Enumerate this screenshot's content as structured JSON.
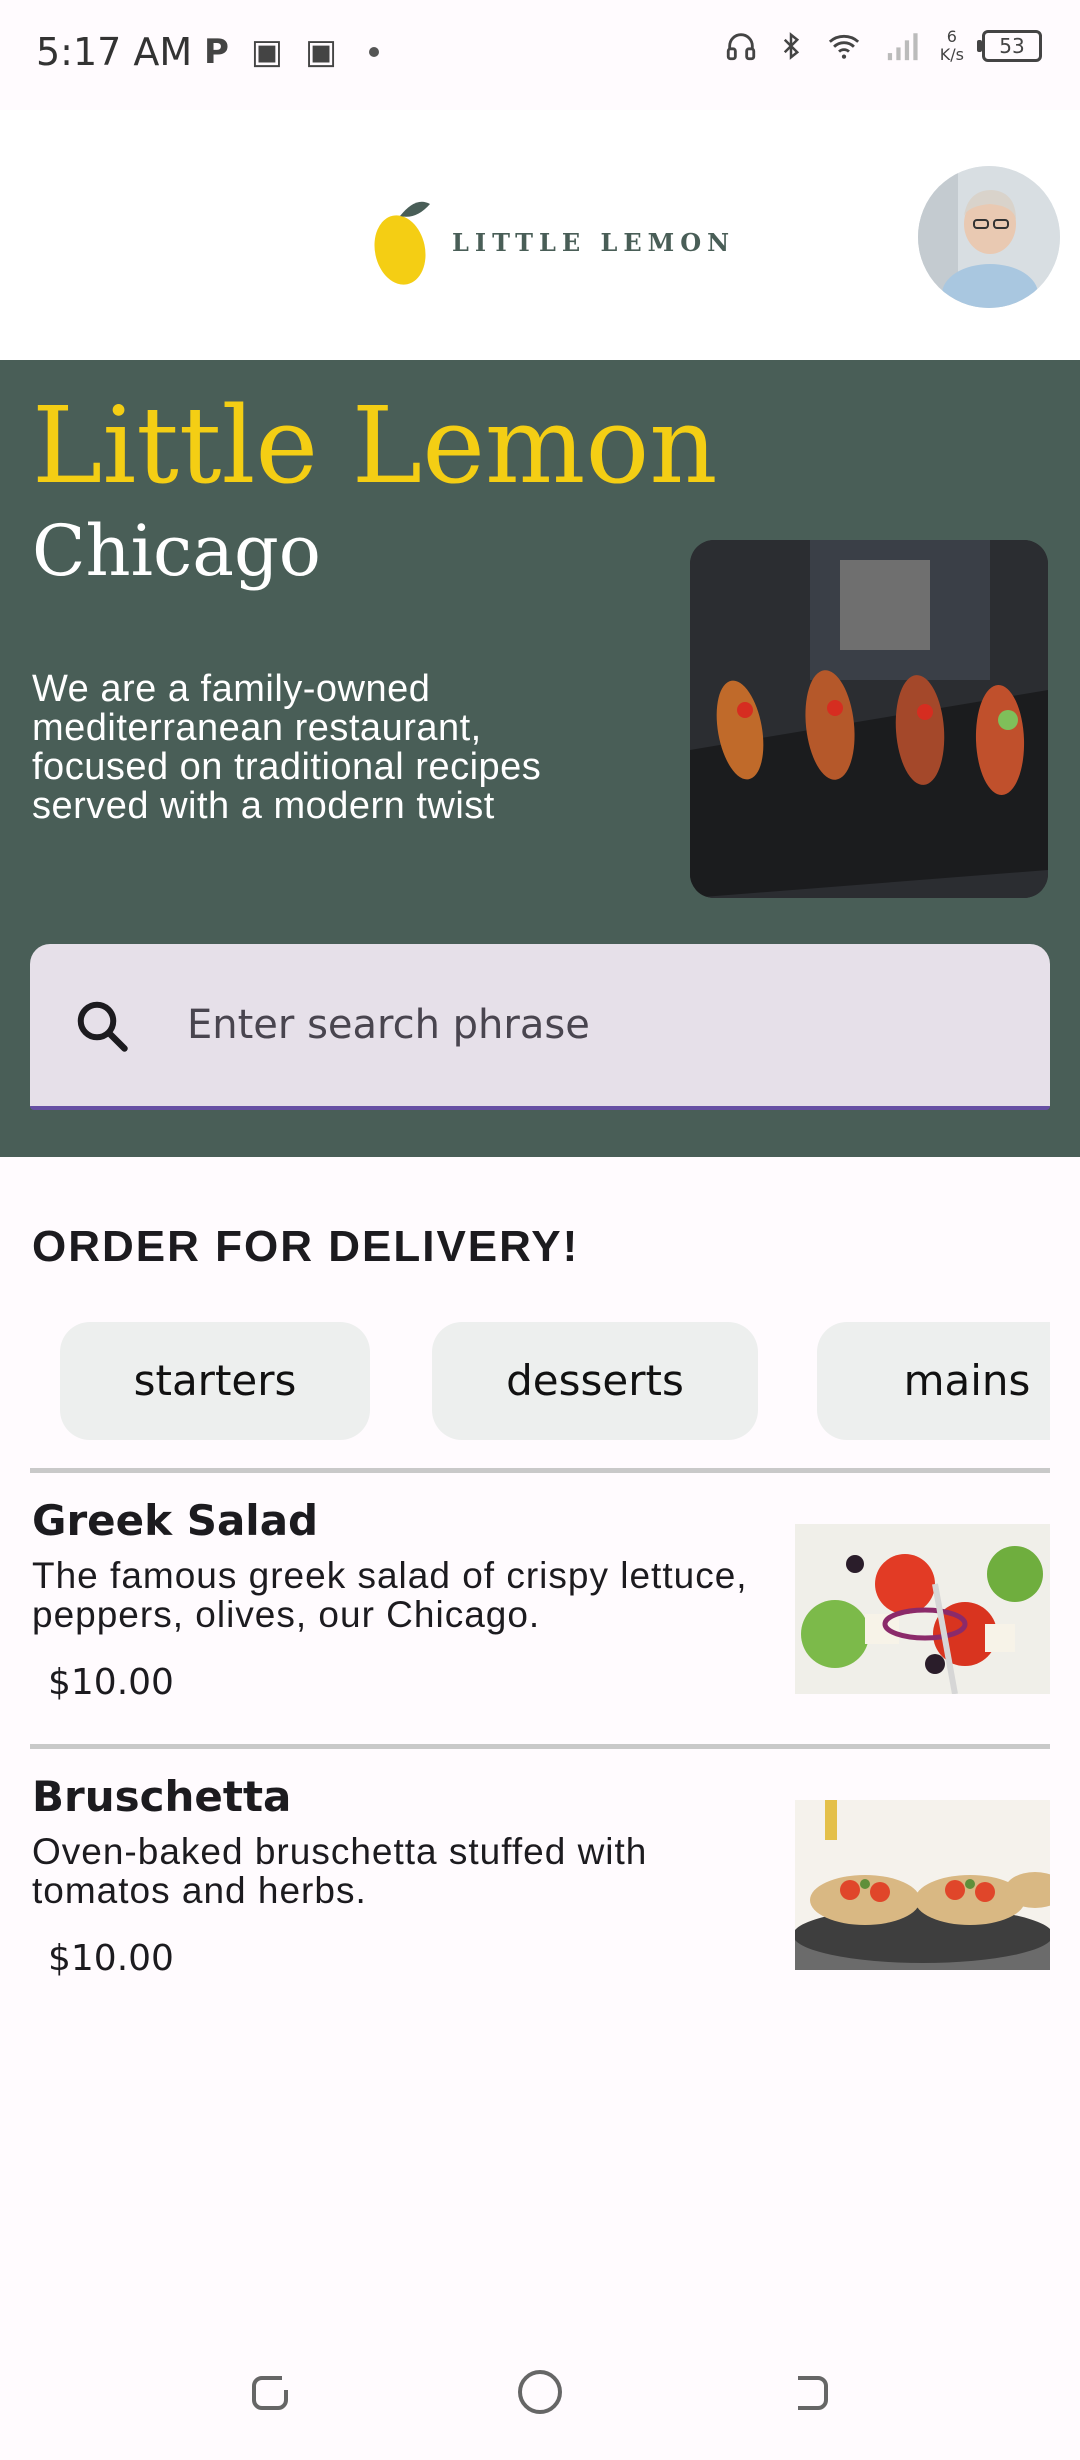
{
  "status_bar": {
    "time": "5:17 AM",
    "left_icons": [
      "parking-icon",
      "app-icon",
      "app-icon",
      "dot"
    ],
    "net_speed_value": "6",
    "net_speed_unit": "K/s",
    "battery": "53"
  },
  "header": {
    "logo_text": "LITTLE LEMON",
    "avatar_icon": "profile-avatar"
  },
  "hero": {
    "title": "Little Lemon",
    "city": "Chicago",
    "description": "We are a family-owned mediterranean restaurant, focused on traditional recipes served with a modern twist",
    "search_placeholder": "Enter search phrase"
  },
  "menu": {
    "section_title": "ORDER FOR DELIVERY!",
    "categories": [
      "starters",
      "desserts",
      "mains"
    ],
    "items": [
      {
        "name": "Greek Salad",
        "description": "The famous greek salad of crispy lettuce, peppers, olives, our Chicago.",
        "price": "$10.00"
      },
      {
        "name": "Bruschetta",
        "description": "Oven-baked bruschetta stuffed with tomatos and herbs.",
        "price": "$10.00"
      }
    ]
  },
  "colors": {
    "primary_green": "#495e57",
    "lemon_yellow": "#f4ce14",
    "search_bg": "#e6e0e9",
    "search_indicator": "#6750a4"
  }
}
